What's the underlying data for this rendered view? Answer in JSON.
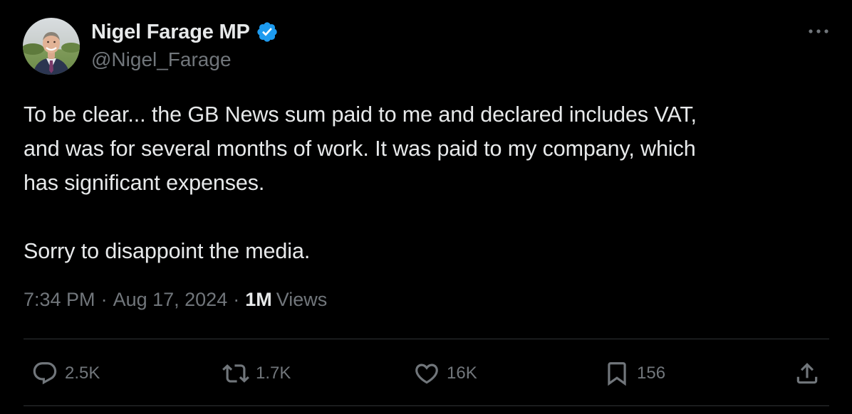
{
  "author": {
    "display_name": "Nigel Farage MP",
    "handle": "@Nigel_Farage",
    "verified": true
  },
  "tweet": {
    "lines": [
      "To be clear... the GB News sum paid to me and declared includes VAT,",
      "and was for several months of work. It was paid to my company, which",
      "has significant expenses."
    ],
    "closing": "Sorry to disappoint the media."
  },
  "meta": {
    "time": "7:34 PM",
    "separator": "·",
    "date": "Aug 17, 2024",
    "views_count": "1M",
    "views_label": "Views"
  },
  "actions": {
    "replies": "2.5K",
    "reposts": "1.7K",
    "likes": "16K",
    "bookmarks": "156"
  },
  "colors": {
    "background": "#000000",
    "text": "#e7e9ea",
    "muted": "#71767b",
    "divider": "#2f3336",
    "verified": "#1d9bf0"
  },
  "icons": {
    "more": "more-horizontal-icon",
    "verified": "verified-badge-icon",
    "reply": "reply-icon",
    "repost": "repost-icon",
    "like": "heart-icon",
    "bookmark": "bookmark-icon",
    "share": "share-icon"
  }
}
